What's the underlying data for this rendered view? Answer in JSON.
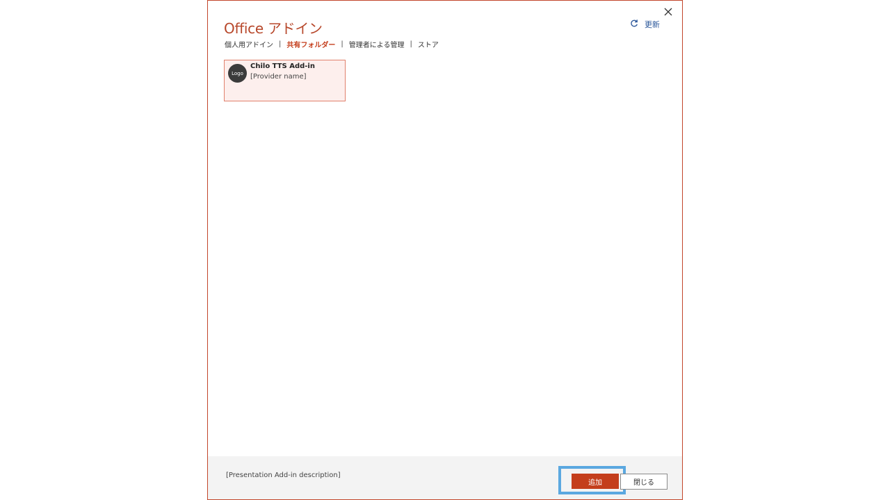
{
  "dialog": {
    "title": "Office アドイン",
    "refresh_label": "更新",
    "tabs": [
      {
        "label": "個人用アドイン",
        "active": false
      },
      {
        "label": "共有フォルダー",
        "active": true
      },
      {
        "label": "管理者による管理",
        "active": false
      },
      {
        "label": "ストア",
        "active": false
      }
    ],
    "separator": "|"
  },
  "addin": {
    "logo_text": "Logo",
    "name": "Chilo TTS Add-in",
    "provider": "[Provider name]"
  },
  "footer": {
    "description": "[Presentation Add-in description]",
    "add_label": "追加",
    "close_label": "閉じる"
  },
  "colors": {
    "accent": "#c43e1c",
    "title": "#b7472a",
    "link": "#2b579a",
    "highlight": "#5ba8e0",
    "card_bg": "#fdefed"
  },
  "icons": {
    "close": "close-icon",
    "refresh": "refresh-icon"
  }
}
